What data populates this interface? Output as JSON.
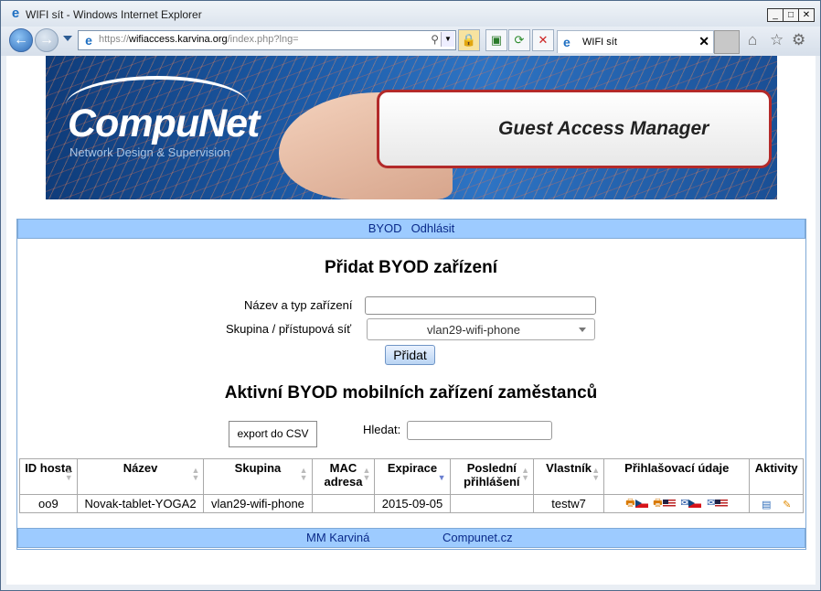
{
  "window": {
    "title": "WIFI sít - Windows Internet Explorer",
    "min": "_",
    "max": "□",
    "close": "✕"
  },
  "browser": {
    "url_prefix": "https://",
    "url_host": "wifiaccess.karvina.org",
    "url_path": "/index.php?lng=",
    "tab_title": "WIFI sít",
    "tab_close": "✕"
  },
  "banner": {
    "brand": "CompuNet",
    "brand_sub": "Network Design & Supervision",
    "product": "Guest Access Manager"
  },
  "menu": {
    "items": [
      "BYOD",
      "Odhlásit"
    ]
  },
  "form": {
    "heading": "Přidat BYOD zařízení",
    "name_label": "Název a typ zařízení",
    "name_value": "",
    "group_label": "Skupina / přístupová síť",
    "group_value": "vlan29-wifi-phone",
    "submit_label": "Přidat"
  },
  "list": {
    "heading": "Aktivní BYOD mobilních zařízení zaměstanců",
    "export_label": "export do CSV",
    "search_label": "Hledat:",
    "search_value": "",
    "columns": [
      "ID hosta",
      "Název",
      "Skupina",
      "MAC adresa",
      "Expirace",
      "Poslední přihlášení",
      "Vlastník",
      "Přihlašovací údaje",
      "Aktivity"
    ],
    "rows": [
      {
        "id": "oo9",
        "name": "Novak-tablet-YOGA2",
        "group": "vlan29-wifi-phone",
        "mac": "",
        "expiry": "2015-09-05",
        "last_login": "",
        "owner": "testw7"
      }
    ]
  },
  "footer": {
    "left": "MM Karviná",
    "right": "Compunet.cz"
  },
  "colors": {
    "menu_bg": "#9dcbff",
    "accent": "#b32a2a",
    "link": "#0a2a8a"
  }
}
